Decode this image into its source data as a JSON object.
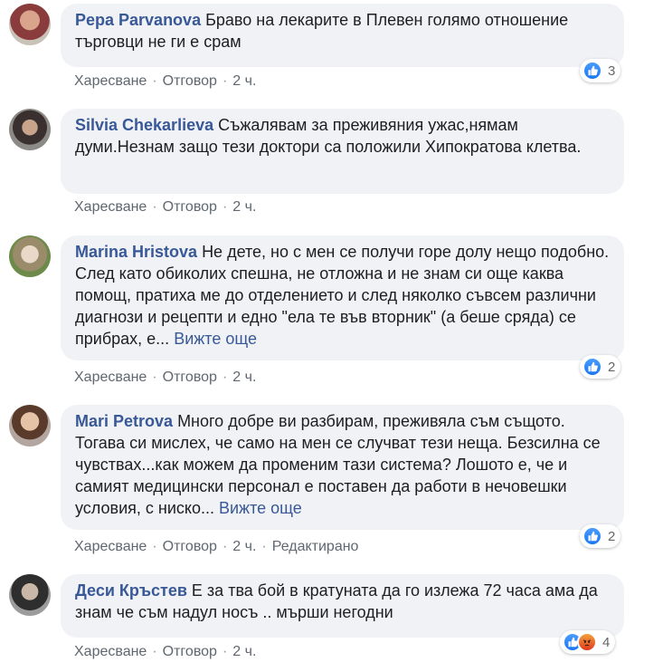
{
  "colors": {
    "author": "#385898",
    "bubble": "#f0f2f5",
    "action": "#606770",
    "like": "#1877f2",
    "angry": "#e0391f"
  },
  "actions": {
    "like": "Харесване",
    "reply": "Отговор",
    "separator": "·"
  },
  "comments": [
    {
      "author": "Pepa Parvanova",
      "text": "Браво на лекарите в Плевен голямо отношение търговци не ги е срам",
      "time": "2 ч.",
      "reactions": {
        "icons": [
          "like-icon"
        ],
        "count": "3"
      }
    },
    {
      "author": "Silvia Chekarlieva",
      "text": "Съжалявам за преживяния ужас,нямам думи.Незнам защо тези доктори са положили Хипократова клетва.",
      "time": "2 ч."
    },
    {
      "author": "Marina Hristova",
      "text": "Не дете, но с мен се получи горе долу нещо подобно. След като обиколих спешна, не отложна и не знам си още каква помощ, пратиха ме до отделението и след няколко съвсем различни диагнози и рецепти и едно \"ела те във вторник\" (а беше сряда) се прибрах, е...",
      "see_more": "Вижте още",
      "time": "2 ч.",
      "reactions": {
        "icons": [
          "like-icon"
        ],
        "count": "2"
      }
    },
    {
      "author": "Mari Petrova",
      "text": "Много добре ви разбирам, преживяла съм същото. Тогава си мислех, че само на мен се случват тези неща. Безсилна се чувствах...как можем да променим тази система? Лошото е, че и самият медицински персонал е поставен да работи в нечовешки условия, с ниско...",
      "see_more": "Вижте още",
      "time": "2 ч.",
      "edited": "Редактирано",
      "reactions": {
        "icons": [
          "like-icon"
        ],
        "count": "2"
      }
    },
    {
      "author": "Деси Кръстев",
      "text": "Е за тва бой в кратуната да го излежа 72 часа ама да знам че съм надул носъ .. мърши негодни",
      "time": "2 ч.",
      "reactions": {
        "icons": [
          "like-icon",
          "angry-icon"
        ],
        "count": "4"
      }
    }
  ]
}
